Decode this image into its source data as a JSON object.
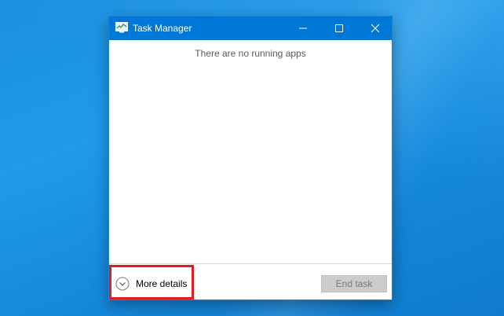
{
  "window": {
    "title": "Task Manager",
    "icon": "task-manager-icon",
    "controls": [
      "minimize-icon",
      "maximize-icon",
      "close-icon"
    ]
  },
  "content": {
    "empty_message": "There are no running apps"
  },
  "footer": {
    "more_details_label": "More details",
    "more_details_icon": "chevron-down-circle-icon",
    "end_task_label": "End task",
    "end_task_enabled": false
  },
  "annotation": {
    "highlight_color": "#e81b23",
    "highlight_target": "more-details-button"
  },
  "colors": {
    "titlebar": "#0078d7",
    "desktop": "#1a8fe0",
    "window_bg": "#ffffff",
    "disabled_button": "#cccccc"
  }
}
